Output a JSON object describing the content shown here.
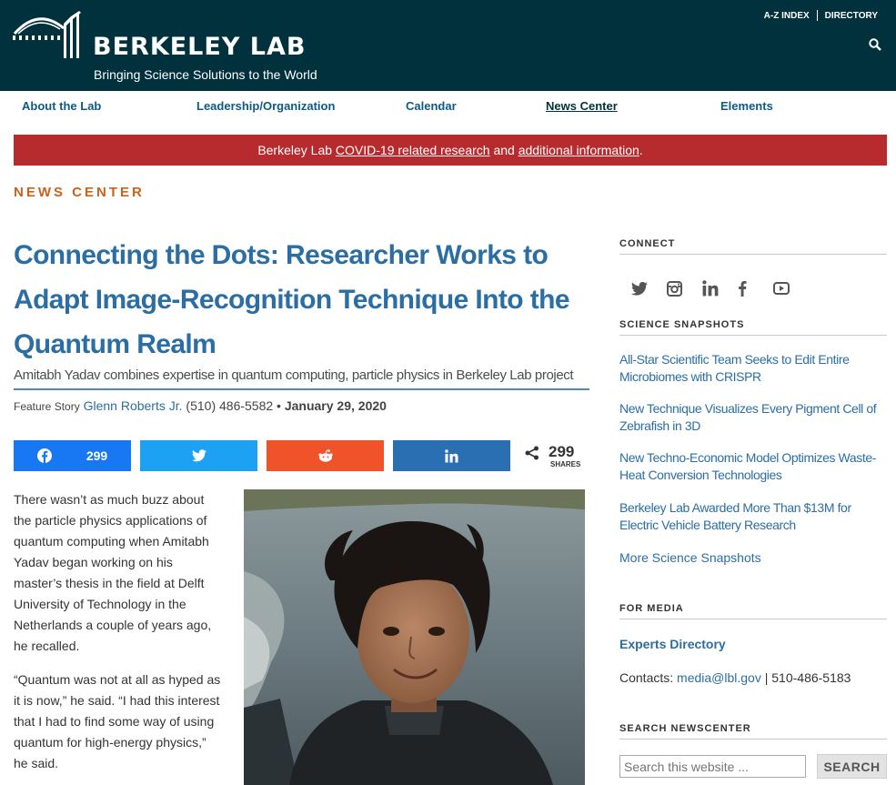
{
  "header": {
    "logo_title": "BERKELEY LAB",
    "tagline": "Bringing Science Solutions to the World",
    "util_links": [
      "A-Z INDEX",
      "DIRECTORY"
    ],
    "bg_color": "#00313c"
  },
  "nav": {
    "items": [
      "About the Lab",
      "Leadership/Organization",
      "Calendar",
      "News Center",
      "Elements"
    ],
    "current": "News Center"
  },
  "alert": {
    "prefix": "Berkeley Lab ",
    "link1": "COVID-19 related research",
    "mid": " and ",
    "link2": "additional information",
    "suffix": ".",
    "color": "#b72b2e"
  },
  "section_label": "NEWS CENTER",
  "article": {
    "headline": "Connecting the Dots: Researcher Works to Adapt Image-Recognition Technique Into the Quantum Realm",
    "subhead": "Amitabh Yadav combines expertise in quantum computing, particle physics in Berkeley Lab project",
    "byline_kind": "Feature Story",
    "author": "Glenn Roberts Jr.",
    "phone": " (510) 486-5582 •",
    "date": "January 29, 2020",
    "paragraphs": [
      "There wasn’t as much buzz about the particle physics applications of quantum computing when Amitabh Yadav began working on his master’s thesis in the field at Delft University of Technology in the Netherlands a couple of years ago, he recalled.",
      "“Quantum was not at all as hyped as it is now,” he said. “I had this interest that I had to find some way of using quantum for high-energy physics,” he said."
    ]
  },
  "share": {
    "facebook_count": "299",
    "total": "299",
    "total_label": "SHARES",
    "colors": {
      "facebook": "#1877f2",
      "twitter": "#1da1f2",
      "reddit": "#f0522a",
      "linkedin": "#2a6fb2"
    },
    "icons": [
      "facebook-icon",
      "twitter-icon",
      "reddit-icon",
      "linkedin-icon",
      "share-icon"
    ]
  },
  "sidebar": {
    "connect_heading": "CONNECT",
    "social_icons": [
      "twitter-icon",
      "instagram-icon",
      "linkedin-icon",
      "facebook-icon",
      "youtube-icon"
    ],
    "snapshots_heading": "SCIENCE SNAPSHOTS",
    "snapshots": [
      "All-Star Scientific Team Seeks to Edit Entire Microbiomes with CRISPR",
      "New Technique Visualizes Every Pigment Cell of Zebrafish in 3D",
      "New Techno-Economic Model Optimizes Waste-Heat Conversion Technologies",
      "Berkeley Lab Awarded More Than $13M for Electric Vehicle Battery Research"
    ],
    "more_snapshots": "More Science Snapshots",
    "media_heading": "FOR MEDIA",
    "experts_link": "Experts Directory",
    "contacts_label": "Contacts: ",
    "contacts_email": "media@lbl.gov",
    "contacts_phone": " | 510-486-5183",
    "search_heading": "SEARCH NEWSCENTER",
    "search_placeholder": "Search this website ...",
    "search_button": "SEARCH"
  }
}
